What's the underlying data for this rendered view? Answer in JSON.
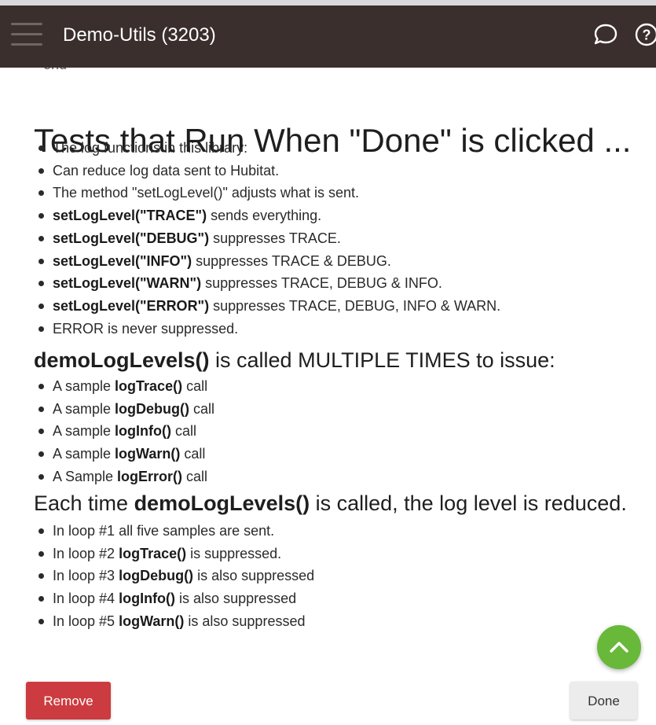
{
  "appbar": {
    "title": "Demo-Utils (3203)",
    "menu_icon": "hamburger-menu-icon",
    "chat_icon": "chat-bubble-icon",
    "help_icon": "help-circle-icon",
    "help_glyph": "?"
  },
  "content": {
    "clipped_text": "end",
    "heading": "Tests that Run When \"Done\" is clicked ...",
    "log_list": [
      {
        "pre": "The log functions in this library:",
        "bold": "",
        "post": ""
      },
      {
        "pre": "Can reduce log data sent to Hubitat.",
        "bold": "",
        "post": ""
      },
      {
        "pre": "The method \"setLogLevel()\" adjusts what is sent.",
        "bold": "",
        "post": ""
      },
      {
        "pre": "",
        "bold": "setLogLevel(\"TRACE\")",
        "post": " sends everything."
      },
      {
        "pre": "",
        "bold": "setLogLevel(\"DEBUG\")",
        "post": " suppresses TRACE."
      },
      {
        "pre": "",
        "bold": "setLogLevel(\"INFO\")",
        "post": " suppresses TRACE & DEBUG."
      },
      {
        "pre": "",
        "bold": "setLogLevel(\"WARN\")",
        "post": " suppresses TRACE, DEBUG & INFO."
      },
      {
        "pre": "",
        "bold": "setLogLevel(\"ERROR\")",
        "post": " suppresses TRACE, DEBUG, INFO & WARN."
      },
      {
        "pre": "ERROR is never suppressed.",
        "bold": "",
        "post": ""
      }
    ],
    "section2": {
      "bold": "demoLogLevels()",
      "post": " is called MULTIPLE TIMES to issue:"
    },
    "samples_list": [
      {
        "pre": "A sample ",
        "bold": "logTrace()",
        "post": " call"
      },
      {
        "pre": "A sample ",
        "bold": "logDebug()",
        "post": " call"
      },
      {
        "pre": "A sample ",
        "bold": "logInfo()",
        "post": " call"
      },
      {
        "pre": "A sample ",
        "bold": "logWarn()",
        "post": " call"
      },
      {
        "pre": "A Sample ",
        "bold": "logError()",
        "post": " call"
      }
    ],
    "section3": {
      "pre": "Each time ",
      "bold": "demoLogLevels()",
      "post": " is called, the log level is reduced."
    },
    "loops_list": [
      {
        "pre": "In loop #1 all five samples are sent.",
        "bold": "",
        "post": ""
      },
      {
        "pre": "In loop #2 ",
        "bold": "logTrace()",
        "post": " is suppressed."
      },
      {
        "pre": "In loop #3 ",
        "bold": "logDebug()",
        "post": " is also suppressed"
      },
      {
        "pre": "In loop #4 ",
        "bold": "logInfo()",
        "post": " is also suppressed"
      },
      {
        "pre": "In loop #5 ",
        "bold": "logWarn()",
        "post": " is also suppressed"
      }
    ]
  },
  "fab": {
    "icon": "chevron-up-icon"
  },
  "footer": {
    "remove_label": "Remove",
    "done_label": "Done"
  },
  "colors": {
    "appbar_bg": "#3a2f2d",
    "remove_bg": "#cc3b3f",
    "fab_bg": "#68b93a",
    "done_bg": "#ececec"
  }
}
